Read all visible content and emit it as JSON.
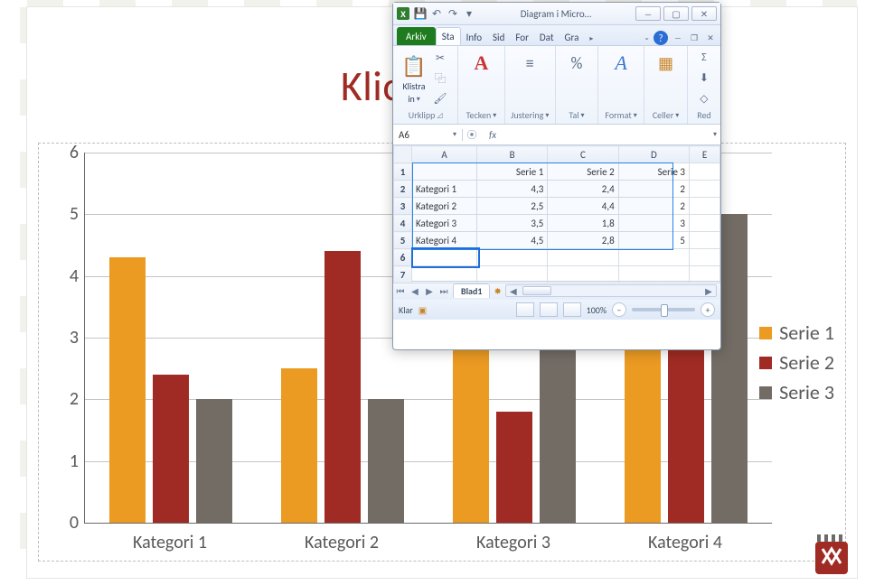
{
  "chart_data": {
    "type": "bar",
    "categories": [
      "Kategori 1",
      "Kategori 2",
      "Kategori 3",
      "Kategori 4"
    ],
    "series": [
      {
        "name": "Serie 1",
        "values": [
          4.3,
          2.5,
          3.5,
          4.5
        ],
        "color": "#eb9a22"
      },
      {
        "name": "Serie 2",
        "values": [
          2.4,
          4.4,
          1.8,
          2.8
        ],
        "color": "#9f2b24"
      },
      {
        "name": "Serie 3",
        "values": [
          2,
          2,
          3,
          5
        ],
        "color": "#726c65"
      }
    ],
    "ylim": [
      0,
      6
    ],
    "yticks": [
      0,
      1,
      2,
      3,
      4,
      5,
      6
    ],
    "legend_position": "right",
    "title": "",
    "xlabel": "",
    "ylabel": ""
  },
  "slide": {
    "title": "Klicka för at"
  },
  "excel": {
    "window_title": "Diagram i Micro…",
    "tab_arkiv": "Arkiv",
    "tabs": [
      "Sta",
      "Info",
      "Sid",
      "For",
      "Dat",
      "Gra"
    ],
    "ribbon": {
      "klistra": "Klistra",
      "klistra2": "in",
      "urklipp": "Urklipp",
      "tecken": "Tecken",
      "justering": "Justering",
      "tal": "Tal",
      "format": "Format",
      "celler": "Celler",
      "red": "Red"
    },
    "namebox": "A6",
    "fx_label": "fx",
    "cols": [
      "A",
      "B",
      "C",
      "D",
      "E"
    ],
    "rows": [
      "1",
      "2",
      "3",
      "4",
      "5",
      "6",
      "7"
    ],
    "headers": {
      "b1": "Serie 1",
      "c1": "Serie 2",
      "d1": "Serie 3"
    },
    "data": {
      "a2": "Kategori 1",
      "b2": "4,3",
      "c2": "2,4",
      "d2": "2",
      "a3": "Kategori 2",
      "b3": "2,5",
      "c3": "4,4",
      "d3": "2",
      "a4": "Kategori 3",
      "b4": "3,5",
      "c4": "1,8",
      "d4": "3",
      "a5": "Kategori 4",
      "b5": "4,5",
      "c5": "2,8",
      "d5": "5"
    },
    "sheet_tab": "Blad1",
    "status": "Klar",
    "zoom": "100%"
  }
}
